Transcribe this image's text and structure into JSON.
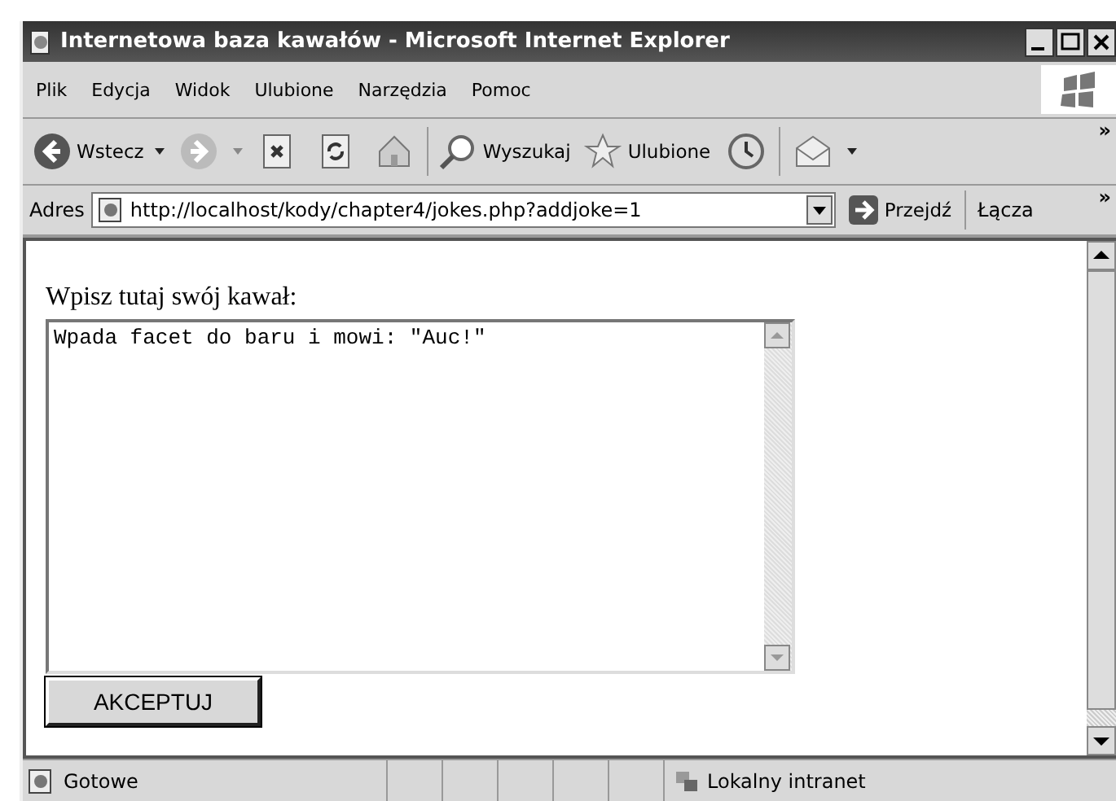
{
  "window": {
    "title": "Internetowa baza kawałów - Microsoft Internet Explorer"
  },
  "menu": [
    "Plik",
    "Edycja",
    "Widok",
    "Ulubione",
    "Narzędzia",
    "Pomoc"
  ],
  "toolbar": {
    "back": "Wstecz",
    "search": "Wyszukaj",
    "favorites": "Ulubione",
    "more": "»"
  },
  "address_bar": {
    "label": "Adres",
    "value": "http://localhost/kody/chapter4/jokes.php?addjoke=1",
    "go": "Przejdź",
    "links": "Łącza",
    "more": "»"
  },
  "page": {
    "label": "Wpisz tutaj swój kawał:",
    "joke_text": "Wpada facet do baru i mowi: \"Auc!\"",
    "submit": "AKCEPTUJ"
  },
  "status_bar": {
    "status": "Gotowe",
    "zone": "Lokalny intranet"
  }
}
